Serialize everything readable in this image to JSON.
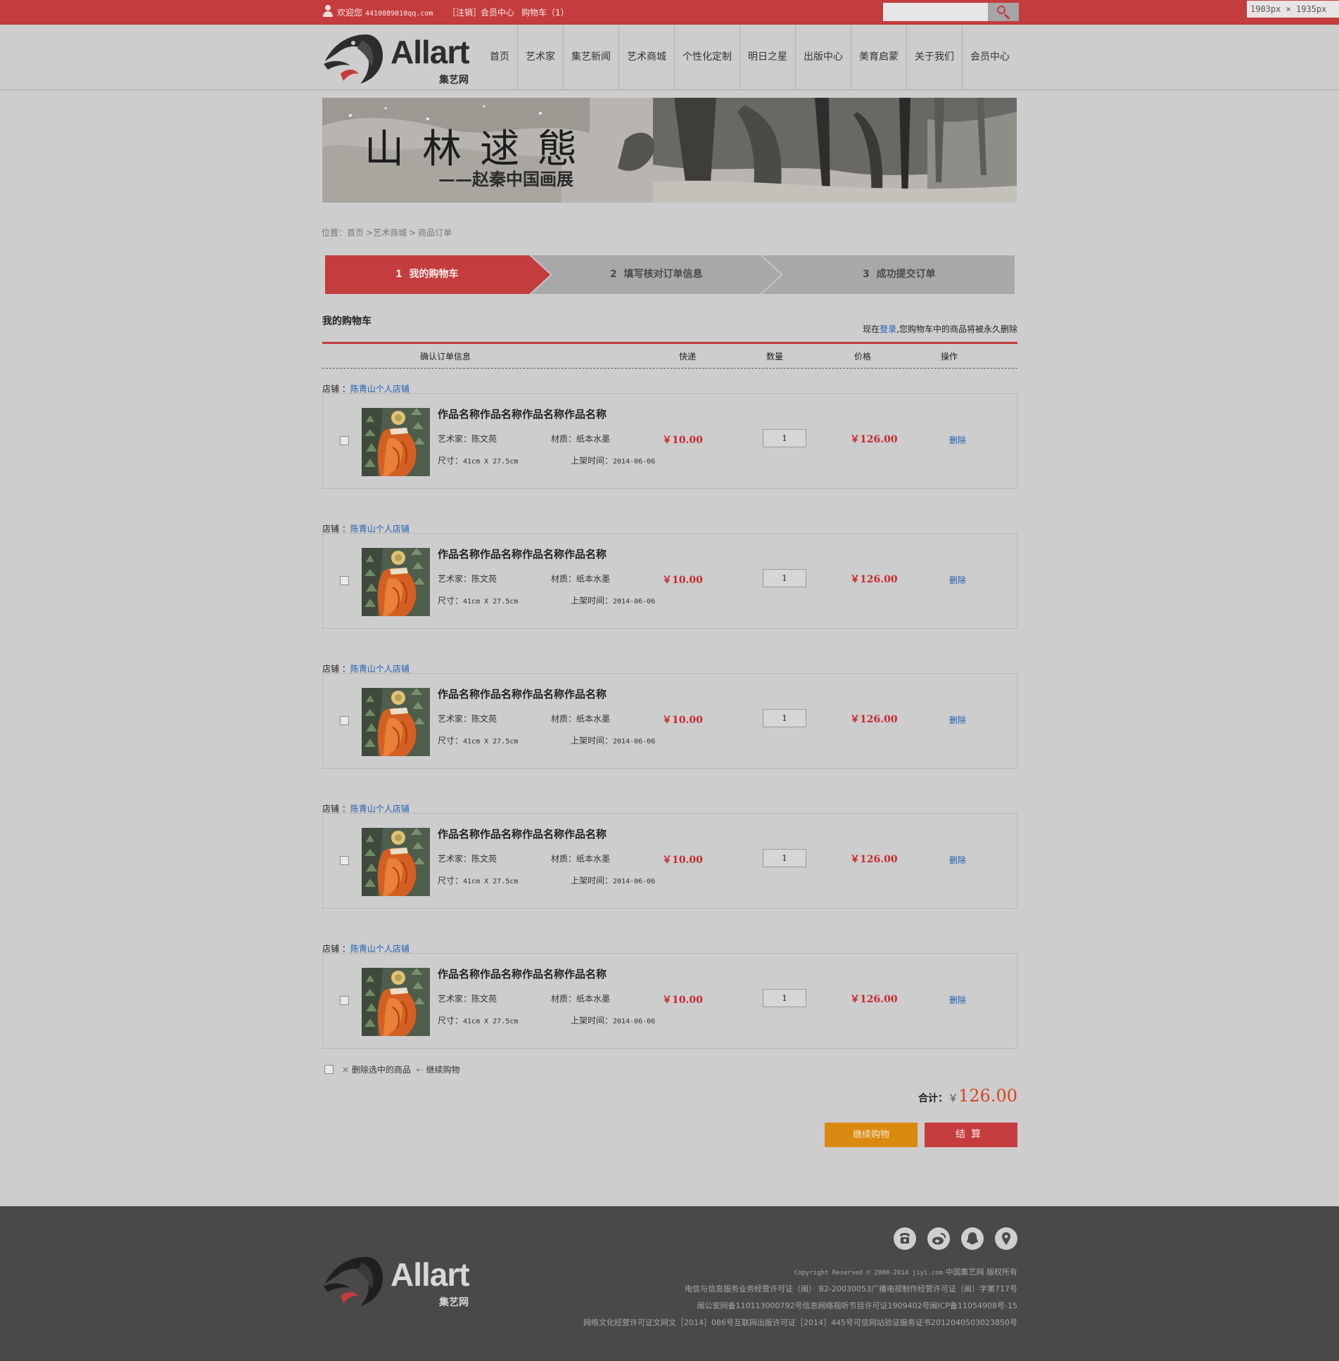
{
  "topbar": {
    "welcome": "欢迎您",
    "email": "4410889810qq.com",
    "logout": "［注销］",
    "member_center": "会员中心",
    "cart": "购物车（1）",
    "search_placeholder": ""
  },
  "size_tag": "1903px × 1935px",
  "logo": {
    "name": "Allart",
    "sub": "集艺网"
  },
  "nav": [
    "首页",
    "艺术家",
    "集艺新闻",
    "艺术商城",
    "个性化定制",
    "明日之星",
    "出版中心",
    "美育启蒙",
    "关于我们",
    "会员中心"
  ],
  "banner": {
    "title": "山林逑態",
    "subtitle": "——赵秦中国画展"
  },
  "breadcrumb": [
    "位置：首页",
    ">艺术商城",
    ">",
    "商品订单"
  ],
  "steps": [
    {
      "num": "1",
      "label": "我的购物车"
    },
    {
      "num": "2",
      "label": "填写核对订单信息"
    },
    {
      "num": "3",
      "label": "成功提交订单"
    }
  ],
  "cart": {
    "title": "我的购物车",
    "note_pre": "现在",
    "note_login": "登录",
    "note_post": ",您购物车中的商品将被永久删除",
    "columns": [
      "确认订单信息",
      "快递",
      "数量",
      "价格",
      "操作"
    ],
    "shop_prefix": "店铺 ：",
    "items": [
      {
        "shop": "陈青山个人店铺",
        "name": "作品名称作品名称作品名称作品名称",
        "artist": "艺术家：陈文苑",
        "material": "材质：纸本水墨",
        "size_label": "尺寸：",
        "size": "41cm X 27.5cm",
        "date_label": "上架时间：",
        "date": "2014-06-06",
        "shipping": "￥10.00",
        "qty": "1",
        "price": "￥126.00",
        "action": "删除"
      },
      {
        "shop": "陈青山个人店铺",
        "name": "作品名称作品名称作品名称作品名称",
        "artist": "艺术家：陈文苑",
        "material": "材质：纸本水墨",
        "size_label": "尺寸：",
        "size": "41cm X 27.5cm",
        "date_label": "上架时间：",
        "date": "2014-06-06",
        "shipping": "￥10.00",
        "qty": "1",
        "price": "￥126.00",
        "action": "删除"
      },
      {
        "shop": "陈青山个人店铺",
        "name": "作品名称作品名称作品名称作品名称",
        "artist": "艺术家：陈文苑",
        "material": "材质：纸本水墨",
        "size_label": "尺寸：",
        "size": "41cm X 27.5cm",
        "date_label": "上架时间：",
        "date": "2014-06-06",
        "shipping": "￥10.00",
        "qty": "1",
        "price": "￥126.00",
        "action": "删除"
      },
      {
        "shop": "陈青山个人店铺",
        "name": "作品名称作品名称作品名称作品名称",
        "artist": "艺术家：陈文苑",
        "material": "材质：纸本水墨",
        "size_label": "尺寸：",
        "size": "41cm X 27.5cm",
        "date_label": "上架时间：",
        "date": "2014-06-06",
        "shipping": "￥10.00",
        "qty": "1",
        "price": "￥126.00",
        "action": "删除"
      },
      {
        "shop": "陈青山个人店铺",
        "name": "作品名称作品名称作品名称作品名称",
        "artist": "艺术家：陈文苑",
        "material": "材质：纸本水墨",
        "size_label": "尺寸：",
        "size": "41cm X 27.5cm",
        "date_label": "上架时间：",
        "date": "2014-06-06",
        "shipping": "￥10.00",
        "qty": "1",
        "price": "￥126.00",
        "action": "删除"
      }
    ],
    "delete_selected": "删除选中的商品",
    "continue_link": "继续购物",
    "total_label": "合计：",
    "total_currency": "￥",
    "total_amount": "126.00",
    "continue_button": "继续购物",
    "checkout_button": "结算"
  },
  "footer": {
    "icons": [
      "phone-icon",
      "weibo-icon",
      "qq-icon",
      "location-icon"
    ],
    "copyright_pre": "Copyright Reserved © 2000-2014 jiyi.com",
    "copyright_post": "中国集艺网 版权所有",
    "line2": "电信与信息服务业务经营许可证（闽） B2-20030053广播电视制作经营许可证（闽）字第717号",
    "line3": "闽公安网备110113000792号信息网络视听节目许可证1909402号闽ICP备11054908号-15",
    "line4": "网络文化经营许可证文网文［2014］086号互联网出版许可证［2014］445号可信网站验证服务证书2012040503023850号"
  },
  "colors": {
    "brand_red": "#c43c3d",
    "orange": "#da8a11",
    "link_blue": "#1f5eb3",
    "price_red": "#c9282b",
    "footer_bg": "#4a4849",
    "page_bg": "#cdcdcd"
  }
}
